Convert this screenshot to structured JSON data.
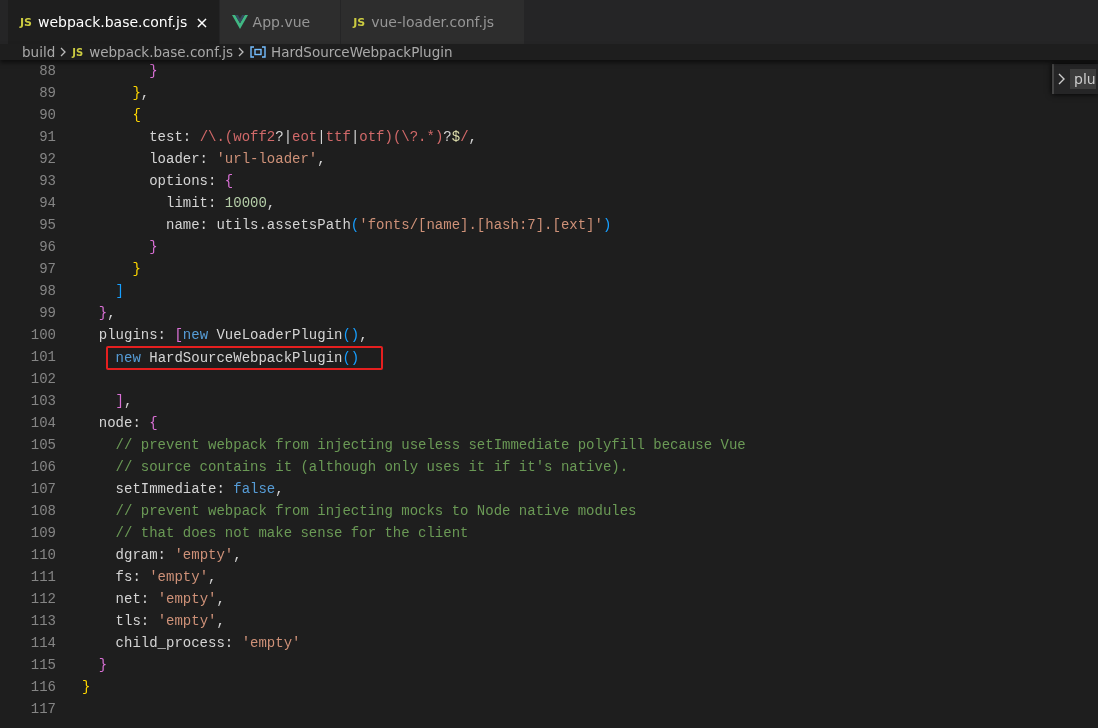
{
  "tabs": [
    {
      "label": "webpack.base.conf.js",
      "selected": true,
      "icon": {
        "kind": "js",
        "text": "JS"
      },
      "close": "×"
    },
    {
      "label": "App.vue",
      "selected": false,
      "icon": {
        "kind": "vue"
      }
    },
    {
      "label": "vue-loader.conf.js",
      "selected": false,
      "icon": {
        "kind": "js",
        "text": "JS"
      }
    }
  ],
  "breadcrumb": [
    {
      "label": "build",
      "icon": {
        "kind": "none"
      }
    },
    {
      "label": "webpack.base.conf.js",
      "icon": {
        "kind": "js",
        "text": "JS"
      }
    },
    {
      "label": "HardSourceWebpackPlugin",
      "icon": {
        "kind": "symbol"
      }
    }
  ],
  "find_widget": {
    "text": "plu"
  },
  "editor": {
    "lines": [
      {
        "number": "88",
        "tokens": [
          {
            "kind": "bracket2",
            "text": "        }"
          }
        ]
      },
      {
        "number": "89",
        "tokens": [
          {
            "kind": "bracket1",
            "text": "      }"
          },
          {
            "kind": "plain",
            "text": ","
          }
        ]
      },
      {
        "number": "90",
        "tokens": [
          {
            "kind": "bracket1",
            "text": "      {"
          }
        ]
      },
      {
        "number": "91",
        "tokens": [
          {
            "kind": "plain",
            "text": "        test: "
          },
          {
            "kind": "regex",
            "text": "/\\.(woff2"
          },
          {
            "kind": "plain",
            "text": "?|"
          },
          {
            "kind": "regex",
            "text": "eot"
          },
          {
            "kind": "plain",
            "text": "|"
          },
          {
            "kind": "regex",
            "text": "ttf"
          },
          {
            "kind": "plain",
            "text": "|"
          },
          {
            "kind": "regex",
            "text": "otf)(\\?.*)"
          },
          {
            "kind": "plain",
            "text": "?"
          },
          {
            "kind": "anchor",
            "text": "$"
          },
          {
            "kind": "regex",
            "text": "/"
          },
          {
            "kind": "plain",
            "text": ","
          }
        ]
      },
      {
        "number": "92",
        "tokens": [
          {
            "kind": "plain",
            "text": "        loader: "
          },
          {
            "kind": "string",
            "text": "'url-loader'"
          },
          {
            "kind": "plain",
            "text": ","
          }
        ]
      },
      {
        "number": "93",
        "tokens": [
          {
            "kind": "plain",
            "text": "        options: "
          },
          {
            "kind": "bracket2",
            "text": "{"
          }
        ]
      },
      {
        "number": "94",
        "tokens": [
          {
            "kind": "plain",
            "text": "          limit: "
          },
          {
            "kind": "number",
            "text": "10000"
          },
          {
            "kind": "plain",
            "text": ","
          }
        ]
      },
      {
        "number": "95",
        "tokens": [
          {
            "kind": "plain",
            "text": "          name: utils.assetsPath"
          },
          {
            "kind": "bracket3",
            "text": "("
          },
          {
            "kind": "string",
            "text": "'fonts/[name].[hash:7].[ext]'"
          },
          {
            "kind": "bracket3",
            "text": ")"
          }
        ]
      },
      {
        "number": "96",
        "tokens": [
          {
            "kind": "bracket2",
            "text": "        }"
          }
        ]
      },
      {
        "number": "97",
        "tokens": [
          {
            "kind": "bracket1",
            "text": "      }"
          }
        ]
      },
      {
        "number": "98",
        "tokens": [
          {
            "kind": "bracket3",
            "text": "    ]"
          }
        ]
      },
      {
        "number": "99",
        "tokens": [
          {
            "kind": "bracket2",
            "text": "  }"
          },
          {
            "kind": "plain",
            "text": ","
          }
        ]
      },
      {
        "number": "100",
        "tokens": [
          {
            "kind": "plain",
            "text": "  plugins: "
          },
          {
            "kind": "bracket2",
            "text": "["
          },
          {
            "kind": "keyword",
            "text": "new"
          },
          {
            "kind": "plain",
            "text": " VueLoaderPlugin"
          },
          {
            "kind": "bracket3",
            "text": "()"
          },
          {
            "kind": "plain",
            "text": ","
          }
        ]
      },
      {
        "number": "101",
        "highlighted": true,
        "tokens": [
          {
            "kind": "keyword",
            "text": "    new"
          },
          {
            "kind": "plain",
            "text": " HardSourceWebpackPlugin"
          },
          {
            "kind": "bracket3",
            "text": "()"
          }
        ]
      },
      {
        "number": "102"
      },
      {
        "number": "103",
        "tokens": [
          {
            "kind": "bracket2",
            "text": "    ]"
          },
          {
            "kind": "plain",
            "text": ","
          }
        ]
      },
      {
        "number": "104",
        "tokens": [
          {
            "kind": "plain",
            "text": "  node: "
          },
          {
            "kind": "bracket2",
            "text": "{"
          }
        ]
      },
      {
        "number": "105",
        "tokens": [
          {
            "kind": "comment",
            "text": "    // prevent webpack from injecting useless setImmediate polyfill because Vue"
          }
        ]
      },
      {
        "number": "106",
        "tokens": [
          {
            "kind": "comment",
            "text": "    // source contains it (although only uses it if it's native)."
          }
        ]
      },
      {
        "number": "107",
        "tokens": [
          {
            "kind": "plain",
            "text": "    setImmediate: "
          },
          {
            "kind": "keyword",
            "text": "false"
          },
          {
            "kind": "plain",
            "text": ","
          }
        ]
      },
      {
        "number": "108",
        "tokens": [
          {
            "kind": "comment",
            "text": "    // prevent webpack from injecting mocks to Node native modules"
          }
        ]
      },
      {
        "number": "109",
        "tokens": [
          {
            "kind": "comment",
            "text": "    // that does not make sense for the client"
          }
        ]
      },
      {
        "number": "110",
        "tokens": [
          {
            "kind": "plain",
            "text": "    dgram: "
          },
          {
            "kind": "string",
            "text": "'empty'"
          },
          {
            "kind": "plain",
            "text": ","
          }
        ]
      },
      {
        "number": "111",
        "tokens": [
          {
            "kind": "plain",
            "text": "    fs: "
          },
          {
            "kind": "string",
            "text": "'empty'"
          },
          {
            "kind": "plain",
            "text": ","
          }
        ]
      },
      {
        "number": "112",
        "tokens": [
          {
            "kind": "plain",
            "text": "    net: "
          },
          {
            "kind": "string",
            "text": "'empty'"
          },
          {
            "kind": "plain",
            "text": ","
          }
        ]
      },
      {
        "number": "113",
        "tokens": [
          {
            "kind": "plain",
            "text": "    tls: "
          },
          {
            "kind": "string",
            "text": "'empty'"
          },
          {
            "kind": "plain",
            "text": ","
          }
        ]
      },
      {
        "number": "114",
        "tokens": [
          {
            "kind": "plain",
            "text": "    child_process: "
          },
          {
            "kind": "string",
            "text": "'empty'"
          }
        ]
      },
      {
        "number": "115",
        "tokens": [
          {
            "kind": "bracket2",
            "text": "  }"
          }
        ]
      },
      {
        "number": "116",
        "tokens": [
          {
            "kind": "bracket1",
            "text": "}"
          }
        ]
      },
      {
        "number": "117"
      }
    ]
  }
}
